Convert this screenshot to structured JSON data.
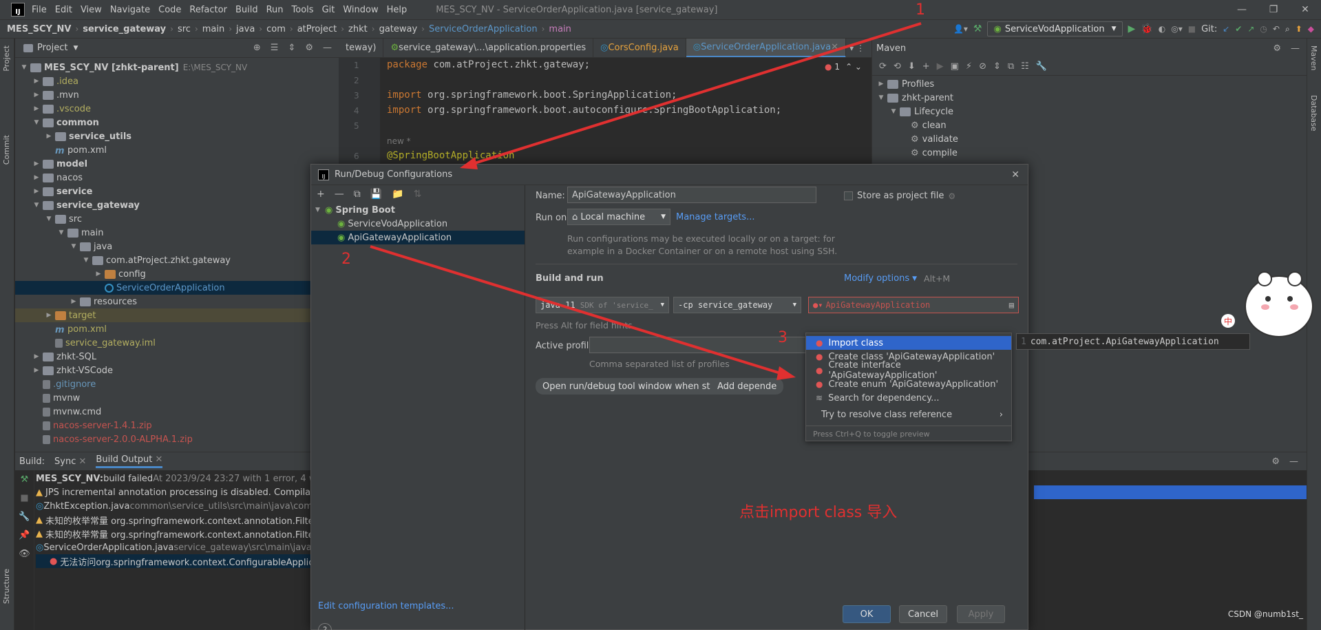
{
  "titlebar": {
    "menus": [
      "File",
      "Edit",
      "View",
      "Navigate",
      "Code",
      "Refactor",
      "Build",
      "Run",
      "Tools",
      "Git",
      "Window",
      "Help"
    ],
    "title": "MES_SCY_NV - ServiceOrderApplication.java [service_gateway]"
  },
  "navbar": {
    "crumbs": [
      "MES_SCY_NV",
      "service_gateway",
      "src",
      "main",
      "java",
      "com",
      "atProject",
      "zhkt",
      "gateway",
      "ServiceOrderApplication",
      "main"
    ],
    "run_config": "ServiceVodApplication",
    "git_label": "Git:"
  },
  "left_strip": {
    "project": "Project",
    "commit": "Commit",
    "structure": "Structure"
  },
  "right_strip": {
    "maven": "Maven",
    "database": "Database"
  },
  "project": {
    "title": "Project",
    "tree": [
      {
        "label": "MES_SCY_NV [zhkt-parent]",
        "extra": "E:\\MES_SCY_NV",
        "indent": 0,
        "open": true,
        "bold": true
      },
      {
        "label": ".idea",
        "indent": 1,
        "color": "olive"
      },
      {
        "label": ".mvn",
        "indent": 1
      },
      {
        "label": ".vscode",
        "indent": 1,
        "color": "olive"
      },
      {
        "label": "common",
        "indent": 1,
        "open": true,
        "bold": true
      },
      {
        "label": "service_utils",
        "indent": 2,
        "bold": true
      },
      {
        "label": "pom.xml",
        "indent": 2,
        "type": "m",
        "leaf": true
      },
      {
        "label": "model",
        "indent": 1,
        "bold": true
      },
      {
        "label": "nacos",
        "indent": 1
      },
      {
        "label": "service",
        "indent": 1,
        "bold": true
      },
      {
        "label": "service_gateway",
        "indent": 1,
        "open": true,
        "bold": true
      },
      {
        "label": "src",
        "indent": 2,
        "open": true
      },
      {
        "label": "main",
        "indent": 3,
        "open": true
      },
      {
        "label": "java",
        "indent": 4,
        "open": true
      },
      {
        "label": "com.atProject.zhkt.gateway",
        "indent": 5,
        "open": true
      },
      {
        "label": "config",
        "indent": 6,
        "color": "normal",
        "folder": "orange"
      },
      {
        "label": "ServiceOrderApplication",
        "indent": 6,
        "color": "blue",
        "type": "java",
        "leaf": true,
        "sel": true
      },
      {
        "label": "resources",
        "indent": 4
      },
      {
        "label": "target",
        "indent": 2,
        "color": "olive",
        "folder": "orange",
        "hl": true
      },
      {
        "label": "pom.xml",
        "indent": 2,
        "type": "m",
        "leaf": true,
        "color": "olive"
      },
      {
        "label": "service_gateway.iml",
        "indent": 2,
        "type": "file",
        "leaf": true,
        "color": "olive"
      },
      {
        "label": "zhkt-SQL",
        "indent": 1
      },
      {
        "label": "zhkt-VSCode",
        "indent": 1
      },
      {
        "label": ".gitignore",
        "indent": 1,
        "type": "file",
        "leaf": true,
        "color": "bluegray"
      },
      {
        "label": "mvnw",
        "indent": 1,
        "type": "file",
        "leaf": true
      },
      {
        "label": "mvnw.cmd",
        "indent": 1,
        "type": "file",
        "leaf": true
      },
      {
        "label": "nacos-server-1.4.1.zip",
        "indent": 1,
        "type": "file",
        "leaf": true,
        "color": "red"
      },
      {
        "label": "nacos-server-2.0.0-ALPHA.1.zip",
        "indent": 1,
        "type": "file",
        "leaf": true,
        "color": "red"
      }
    ]
  },
  "editor": {
    "tabs": [
      "teway)",
      "service_gateway\\...\\application.properties",
      "CorsConfig.java",
      "ServiceOrderApplication.java"
    ],
    "active_tab": 3,
    "lines": [
      "1",
      "2",
      "3",
      "4",
      "5",
      "",
      "6"
    ],
    "code": {
      "l1_kw": "package",
      "l1_rest": " com.atProject.zhkt.gateway;",
      "l3_kw": "import",
      "l3_rest": " org.springframework.boot.SpringApplication;",
      "l4_kw": "import",
      "l4_rest": " org.springframework.boot.autoconfigure.SpringBootApplication;",
      "hint": "new *",
      "l6": "@SpringBootApplication"
    },
    "error_count": "1"
  },
  "maven": {
    "title": "Maven",
    "tree": [
      {
        "label": "Profiles",
        "indent": 0
      },
      {
        "label": "zhkt-parent",
        "indent": 0,
        "open": true
      },
      {
        "label": "Lifecycle",
        "indent": 1,
        "open": true
      },
      {
        "label": "clean",
        "indent": 2,
        "gear": true
      },
      {
        "label": "validate",
        "indent": 2,
        "gear": true
      },
      {
        "label": "compile",
        "indent": 2,
        "gear": true
      }
    ],
    "error_num": "0"
  },
  "build": {
    "tabs": {
      "build": "Build:",
      "sync": "Sync",
      "output": "Build Output"
    },
    "lines": [
      {
        "icon": "",
        "bold": "MES_SCY_NV:",
        "text": " build failed",
        "gray": " At 2023/9/24 23:27 with 1 error, 4 warnings"
      },
      {
        "icon": "warn",
        "text": "JPS incremental annotation processing is disabled. Compilation r"
      },
      {
        "icon": "",
        "text": "ZhktException.java",
        "gray": " common\\service_utils\\src\\main\\java\\com\\atPr"
      },
      {
        "icon": "warn",
        "text": "未知的枚举常量 org.springframework.context.annotation.FilterType"
      },
      {
        "icon": "warn",
        "text": "未知的枚举常量 org.springframework.context.annotation.FilterType"
      },
      {
        "icon": "",
        "text": "ServiceOrderApplication.java",
        "gray": " service_gateway\\src\\main\\java\\com"
      },
      {
        "icon": "err",
        "text": "无法访问org.springframework.context.ConfigurableApplication",
        "sel": true
      }
    ]
  },
  "dialog": {
    "title": "Run/Debug Configurations",
    "tree_group": "Spring Boot",
    "tree_items": [
      "ServiceVodApplication",
      "ApiGatewayApplication"
    ],
    "name_label": "Name:",
    "name_value": "ApiGatewayApplication",
    "store_label": "Store as project file",
    "run_on_label": "Run on:",
    "run_on_value": "Local machine",
    "manage_targets": "Manage targets...",
    "run_on_hint1": "Run configurations may be executed locally or on a target: for",
    "run_on_hint2": "example in a Docker Container or on a remote host using SSH.",
    "build_run_label": "Build and run",
    "modify_options": "Modify options",
    "modify_shortcut": "Alt+M",
    "jdk_value": "java 11",
    "jdk_hint": "SDK of 'service_",
    "cp_value": "-cp service_gateway",
    "main_class_value": "ApiGatewayApplication",
    "alt_hint": "Press Alt for field hints",
    "active_profiles_label": "Active profiles:",
    "profiles_hint": "Comma separated list of profiles",
    "chip1": "Open run/debug tool window when started",
    "chip2": "Add depende",
    "edit_templates": "Edit configuration templates...",
    "ok": "OK",
    "cancel": "Cancel",
    "apply": "Apply",
    "help": "?"
  },
  "popup": {
    "items": [
      "Import class",
      "Create class 'ApiGatewayApplication'",
      "Create interface 'ApiGatewayApplication'",
      "Create enum 'ApiGatewayApplication'",
      "Search for dependency...",
      "Try to resolve class reference"
    ],
    "footer": "Press Ctrl+Q to toggle preview",
    "preview_num": "1",
    "preview_text": "com.atProject.ApiGatewayApplication"
  },
  "annotations": {
    "n1": "1",
    "n2": "2",
    "n3": "3",
    "note": "点击import class 导入",
    "zh": "中"
  },
  "watermark": "CSDN @numb1st_",
  "colors": {
    "arrow": "#e03030",
    "accent": "#4a88c7",
    "selection": "#2f65ca"
  }
}
